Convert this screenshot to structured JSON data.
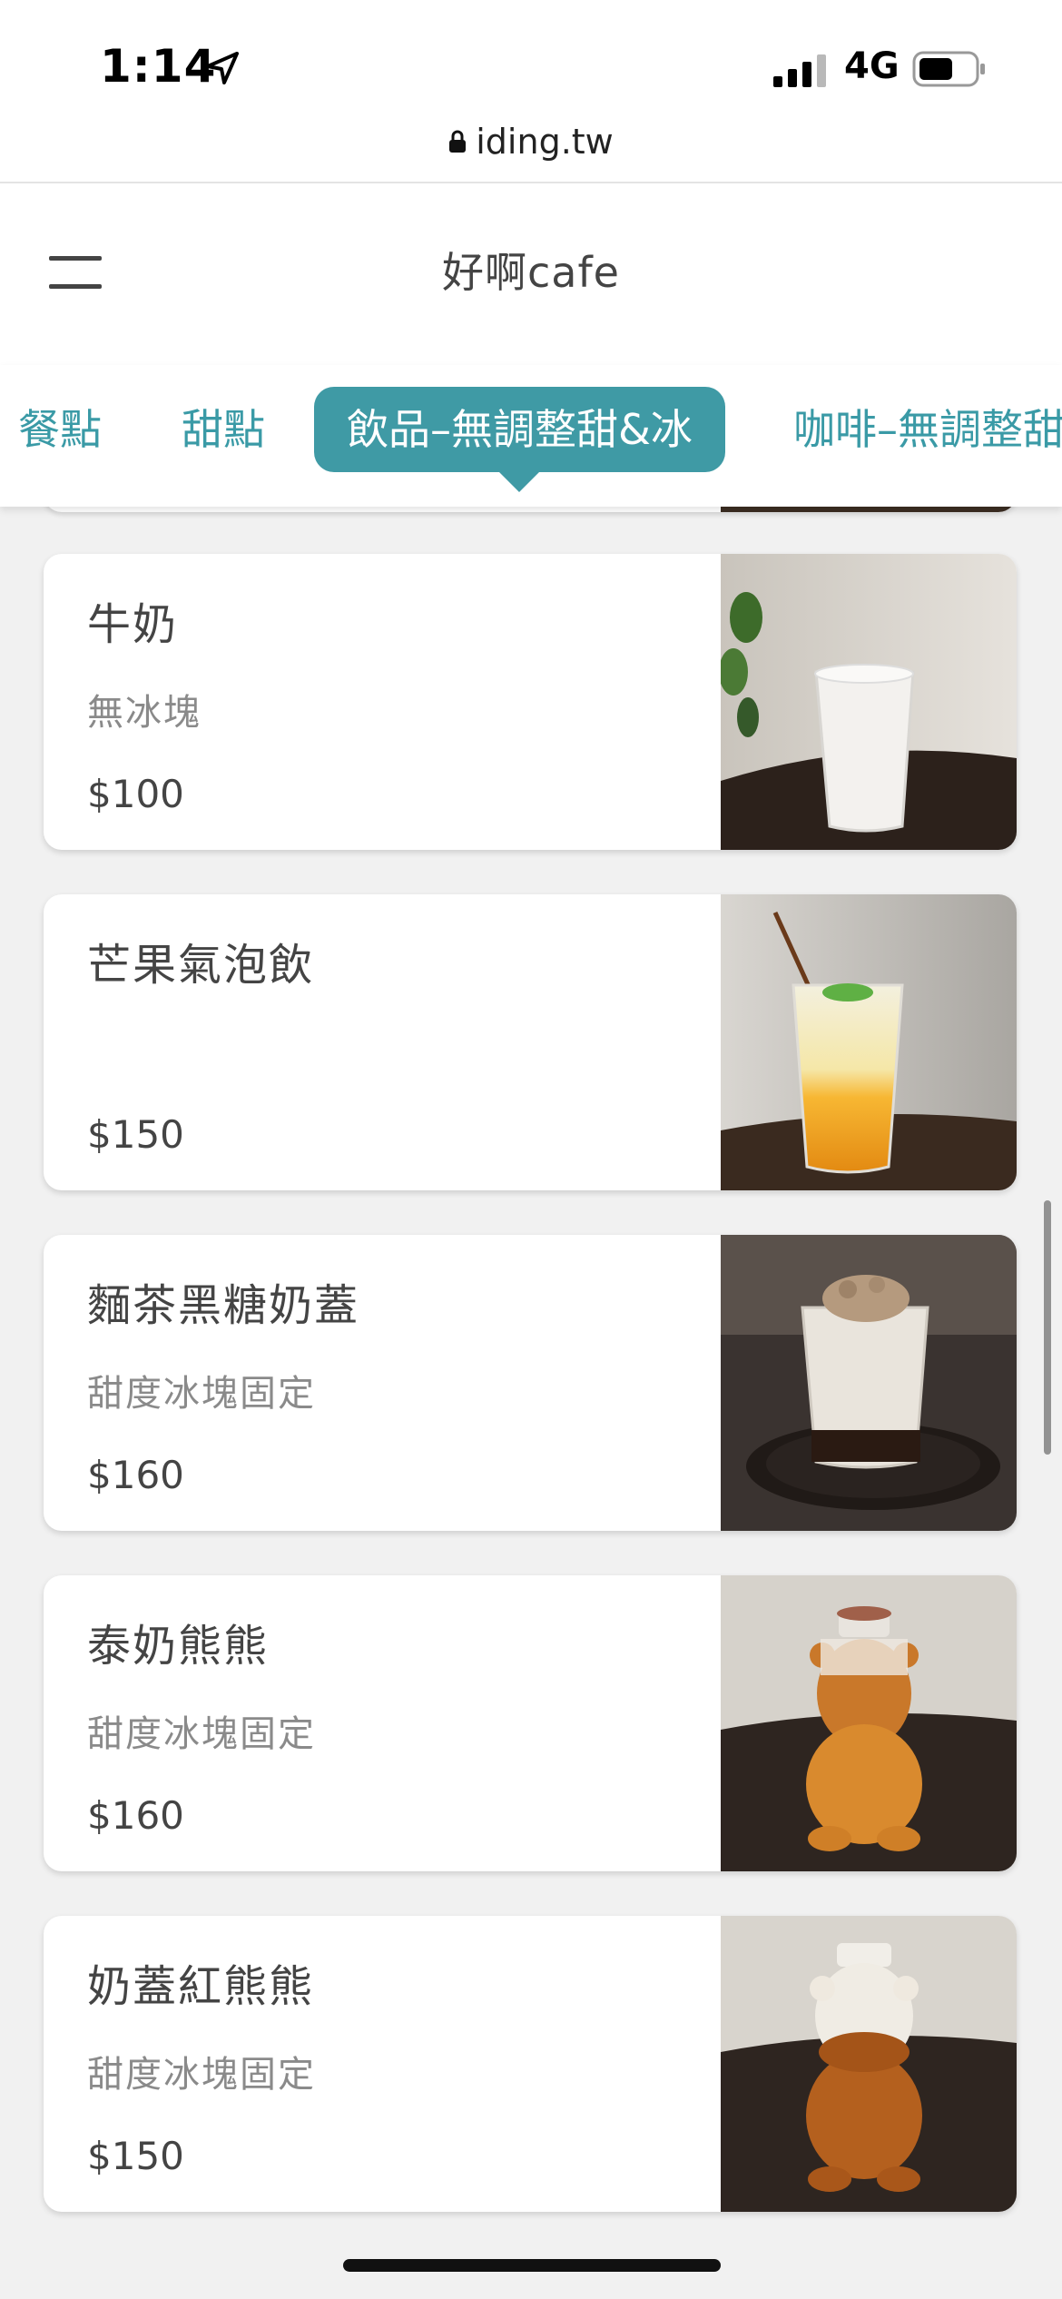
{
  "status_bar": {
    "time": "1:14",
    "network": "4G",
    "icons": [
      "location-arrow-icon",
      "signal-bars-icon",
      "battery-icon"
    ]
  },
  "browser": {
    "url": "iding.tw",
    "lock_icon": "lock-icon"
  },
  "header": {
    "title": "好啊cafe",
    "menu_icon": "hamburger-menu-icon"
  },
  "tabs": [
    {
      "label": "餐點",
      "active": false
    },
    {
      "label": "甜點",
      "active": false
    },
    {
      "label": "飲品–無調整甜&冰",
      "active": true
    },
    {
      "label": "咖啡–無調整甜",
      "active": false
    }
  ],
  "colors": {
    "accent": "#3f9aa5",
    "tab_text": "#3a9aa6",
    "background": "#f1f1f1"
  },
  "items": [
    {
      "name": "牛奶",
      "desc": "無冰塊",
      "price": "$100"
    },
    {
      "name": "芒果氣泡飲",
      "desc": "",
      "price": "$150"
    },
    {
      "name": "麵茶黑糖奶蓋",
      "desc": "甜度冰塊固定",
      "price": "$160"
    },
    {
      "name": "泰奶熊熊",
      "desc": "甜度冰塊固定",
      "price": "$160"
    },
    {
      "name": "奶蓋紅熊熊",
      "desc": "甜度冰塊固定",
      "price": "$150"
    }
  ]
}
